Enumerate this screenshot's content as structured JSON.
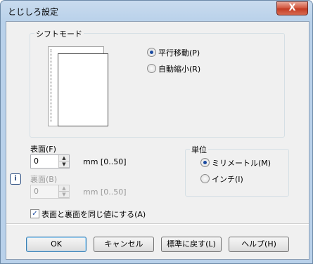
{
  "window": {
    "title": "とじしろ設定",
    "close_label": "X"
  },
  "shift_mode": {
    "group_label": "シフトモード",
    "options": [
      {
        "label": "平行移動(P)",
        "selected": true
      },
      {
        "label": "自動縮小(R)",
        "selected": false
      }
    ]
  },
  "front": {
    "label": "表面(F)",
    "value": "0",
    "range": "mm [0..50]"
  },
  "back": {
    "label": "裏面(B)",
    "value": "0",
    "range": "mm [0..50]",
    "disabled": true
  },
  "units": {
    "group_label": "単位",
    "options": [
      {
        "label": "ミリメートル(M)",
        "selected": true
      },
      {
        "label": "インチ(I)",
        "selected": false
      }
    ]
  },
  "same_value_checkbox": {
    "label": "表面と裏面を同じ値にする(A)",
    "checked": true
  },
  "buttons": {
    "ok": "OK",
    "cancel": "キャンセル",
    "reset": "標準に戻す(L)",
    "help": "ヘルプ(H)"
  },
  "colors": {
    "accent": "#1a4aa0",
    "window_frame": "#b9d1ea",
    "close": "#c23a22"
  }
}
